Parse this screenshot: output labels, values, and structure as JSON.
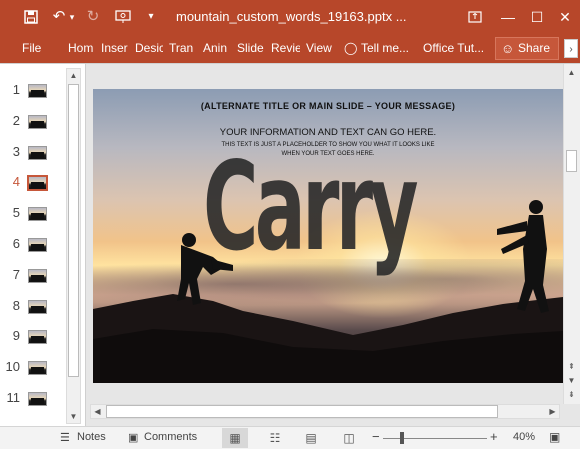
{
  "titlebar": {
    "title": "mountain_custom_words_19163.pptx ...",
    "save_icon": "save-icon",
    "undo_icon": "undo-icon",
    "undo_dropdown": "▾",
    "redo_icon": "redo-icon",
    "start_icon": "present-from-start-icon",
    "customize_icon": "customize-qat-icon",
    "ribbon_options_icon": "ribbon-display-options-icon",
    "minimize": "—",
    "maximize": "☐",
    "close": "✕"
  },
  "ribbon": {
    "tabs": [
      "File",
      "Hom",
      "Inser",
      "Desic",
      "Tran",
      "Anin",
      "Slide",
      "Revie",
      "View"
    ],
    "tell_me": "Tell me...",
    "office_tutorial": "Office Tut...",
    "share": "Share"
  },
  "thumbnails": {
    "numbers": [
      "1",
      "2",
      "3",
      "4",
      "5",
      "6",
      "7",
      "8",
      "9",
      "10",
      "11"
    ],
    "active_index": 4
  },
  "slide": {
    "title": "(ALTERNATE TITLE  OR MAIN SLIDE – YOUR MESSAGE)",
    "info": "YOUR INFORMATION AND TEXT CAN GO HERE.",
    "placeholder_line1": "THIS TEXT IS JUST A PLACEHOLDER TO SHOW YOU WHAT IT LOOKS LIKE",
    "placeholder_line2": "WHEN YOUR TEXT GOES HERE.",
    "big_word": "Carry"
  },
  "statusbar": {
    "notes": "Notes",
    "comments": "Comments",
    "zoom_minus": "−",
    "zoom_plus": "+",
    "zoom_level": "40%",
    "zoom_fraction": 0.4
  },
  "colors": {
    "accent": "#b7472a",
    "active_thumb": "#c6573a"
  }
}
